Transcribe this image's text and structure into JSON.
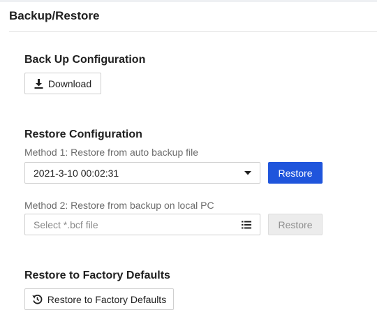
{
  "page": {
    "title": "Backup/Restore"
  },
  "backup": {
    "heading": "Back Up Configuration",
    "download_label": "Download"
  },
  "restore": {
    "heading": "Restore Configuration",
    "method1_label": "Method 1: Restore from auto backup file",
    "method1_selected": "2021-3-10 00:02:31",
    "method1_button": "Restore",
    "method2_label": "Method 2: Restore from backup on local PC",
    "method2_placeholder": "Select *.bcf file",
    "method2_button": "Restore"
  },
  "factory": {
    "heading": "Restore to Factory Defaults",
    "button_label": "Restore to Factory Defaults"
  },
  "icons": {
    "download": "download-icon",
    "dropdown": "caret-down-icon",
    "browse": "list-icon",
    "factory_reset": "history-icon"
  },
  "colors": {
    "primary": "#1f55dc",
    "disabled_bg": "#ececec"
  }
}
